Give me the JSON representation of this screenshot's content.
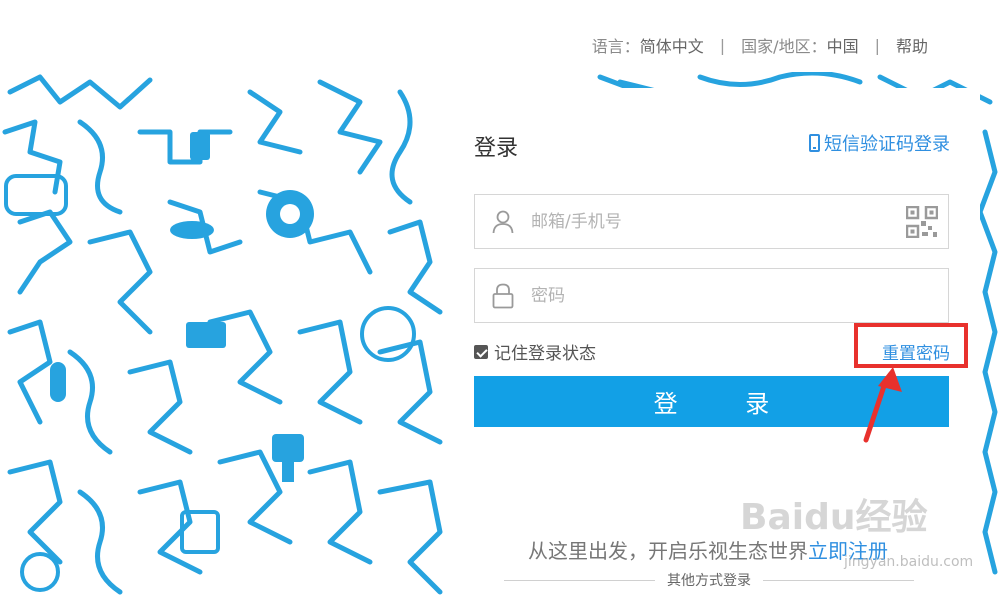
{
  "topnav": {
    "language_label": "语言：",
    "language_value": "简体中文",
    "separator": "|",
    "region_label": "国家/地区：",
    "region_value": "中国",
    "help": "帮助"
  },
  "login": {
    "title": "登录",
    "sms_login": "短信验证码登录",
    "account_placeholder": "邮箱/手机号",
    "password_placeholder": "密码",
    "remember_label": "记住登录状态",
    "remember_checked": true,
    "reset_password": "重置密码",
    "submit": "登 录",
    "slogan_text": "从这里出发，开启乐视生态世界",
    "register": "立即注册",
    "other_methods": "其他方式登录"
  },
  "colors": {
    "accent": "#12a0e6",
    "link": "#2f8fe0",
    "doodle": "#27a3df",
    "highlight": "#e8312d"
  },
  "icons": [
    "phone-icon",
    "user-icon",
    "lock-icon",
    "qr-code-icon",
    "checkbox-icon",
    "arrow-icon"
  ],
  "watermark": {
    "main": "Baidu经验",
    "sub": "jingyan.baidu.com"
  }
}
